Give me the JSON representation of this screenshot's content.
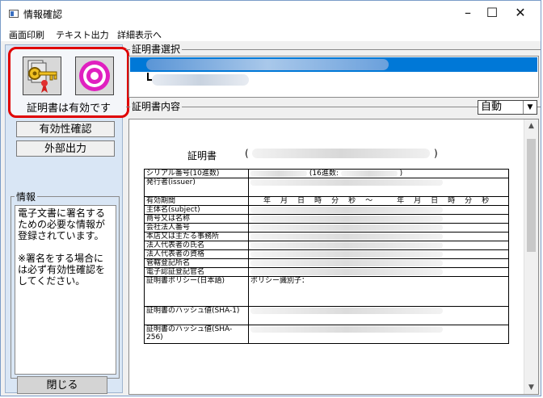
{
  "window": {
    "title": "情報確認",
    "minimize": "–",
    "maximize": "☐",
    "close": "✕"
  },
  "menu": [
    "画面印刷",
    "テキスト出力",
    "詳細表示へ"
  ],
  "sidebar": {
    "status_label": "証明書は有効です",
    "check_button": "有効性確認",
    "export_button": "外部出力",
    "info_legend": "情報",
    "info_text": "電子文書に署名するための必要な情報が登録されています。\n\n※署名をする場合には必ず有効性確認をしてください。",
    "close_button": "閉じる",
    "icons": [
      "certificate-key-icon",
      "target-icon"
    ]
  },
  "selection": {
    "legend": "証明書選択"
  },
  "content": {
    "legend": "証明書内容",
    "mode_select": "自動",
    "doc_title": "証明書",
    "paren_open": "(",
    "paren_close": ")"
  },
  "cert_table": {
    "serial_label": "シリアル番号(10進数)",
    "serial_hex_label": "(16進数:",
    "serial_hex_close": ")",
    "issuer_label": "発行者(issuer)",
    "period_label": "有効期間",
    "period_units": [
      "年",
      "月",
      "日",
      "時",
      "分",
      "秒"
    ],
    "period_sep": "～",
    "subject_label": "主体名(subject)",
    "rows": [
      "商号又は名称",
      "会社法人番号",
      "本店又は主たる事務所",
      "法人代表者の氏名",
      "法人代表者の資格",
      "管轄登記所名",
      "電子認証登記官名"
    ],
    "policy_label": "証明書ポリシー(日本語)",
    "policy_value": "ポリシー識別子：",
    "hash1_label": "証明書のハッシュ値(SHA-1)",
    "hash256_label": "証明書のハッシュ値(SHA-256)"
  },
  "colors": {
    "accent_red": "#e00000",
    "selection_blue": "#0078d7",
    "panel_blue": "#d9e6f5"
  }
}
